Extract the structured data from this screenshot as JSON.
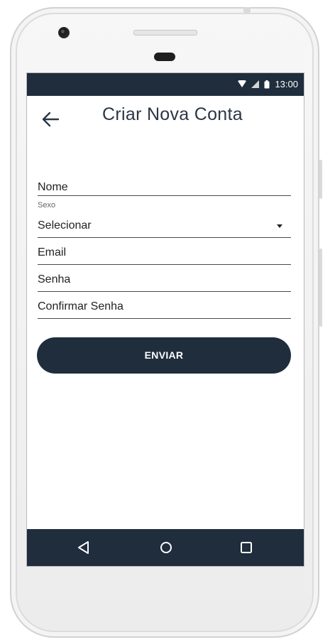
{
  "status_bar": {
    "time": "13:00"
  },
  "header": {
    "title": "Criar Nova Conta"
  },
  "form": {
    "name_placeholder": "Nome",
    "sex_label": "Sexo",
    "sex_value": "Selecionar",
    "email_placeholder": "Email",
    "password_placeholder": "Senha",
    "confirm_password_placeholder": "Confirmar Senha",
    "submit_label": "ENVIAR"
  },
  "navigation": {
    "back": "triangle-left-icon",
    "home": "circle-home-icon",
    "recents": "square-recents-icon"
  },
  "colors": {
    "primary": "#1f2d3d",
    "background": "#ffffff",
    "title": "#2b3645"
  }
}
